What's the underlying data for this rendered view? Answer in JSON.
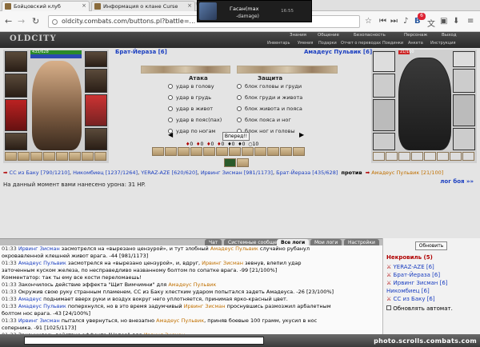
{
  "browser": {
    "tabs": [
      {
        "title": "Бойцовский клуб"
      },
      {
        "title": "Информация о клане Curse"
      }
    ],
    "url": "oldcity.combats.com/buttons.pl?battle=...",
    "notification": {
      "name": "Гасан(max",
      "sub": "-damage)",
      "time": "16:55"
    },
    "badge": "6"
  },
  "game_header": {
    "logo": "OLDCITY",
    "menu": [
      "Знания",
      "Общение",
      "Безопасность",
      "Персонаж",
      "Выход"
    ],
    "submenu": [
      "Инвентарь",
      "Умения",
      "Подарки",
      "Отчет о переводах",
      "Поединки",
      "Анкета",
      "Инструкция"
    ]
  },
  "fighters": {
    "left": {
      "name": "Брат-Йераза [6]",
      "hp": "435/628"
    },
    "right": {
      "name": "Амадеус Пульвик [6]",
      "hp": "21/100"
    }
  },
  "attack": {
    "heading": "Атака",
    "options": [
      "удар в голову",
      "удар в грудь",
      "удар в живот",
      "удар в пояс(пах)",
      "удар по ногам"
    ]
  },
  "defense": {
    "heading": "Защита",
    "options": [
      "блок головы и груди",
      "блок груди и живота",
      "блок живота и пояса",
      "блок пояса и ног",
      "блок ног и головы"
    ]
  },
  "go_button": "Вперед!!",
  "counters": [
    "0",
    "0",
    "0",
    "0",
    "0",
    "0",
    "10"
  ],
  "players_line": {
    "left": [
      "СС из Баку [790/1210]",
      "Никомбиец [1237/1264]",
      "YERAZ-AZE [620/620]",
      "Ирвинг Зисман [981/1173]",
      "Брат-Йераза [435/628]"
    ],
    "vs": "против",
    "right": "Амадеус Пульвик [21/100]"
  },
  "damage_line": "На данный момент вами нанесено урона: 31 HP.",
  "fight_log_link": "лог боя »»",
  "log_tabs": [
    "Чат",
    "Системные сообщения",
    "Все логи",
    "Мои логи",
    "Настройки"
  ],
  "log": [
    {
      "t": "01:33",
      "a": "Ирвинг Зисман",
      "text": " засмотрелся на «вырезано цензурой», и тут злобный ",
      "b": "Амадеус Пульвик",
      "c": " случайно рубанул"
    },
    {
      "t": "",
      "a": "",
      "text": "окровавленной клешней живот врага. -44 [981/1173]",
      "b": "",
      "c": ""
    },
    {
      "t": "01:33",
      "a": "Амадеус Пульвик",
      "text": " засмотрелся на «вырезано цензурой», и, вдруг, ",
      "b": "Ирвинг Зисман",
      "c": " зевнув, влепил удар"
    },
    {
      "t": "",
      "a": "",
      "text": "заточенным куском железа, по несправедливо названному болтом по сопатке врага. -99 [21/100%]",
      "b": "",
      "c": ""
    },
    {
      "t": "",
      "a": "",
      "text": "Комментатор: так ты ему все кости переломаешь!",
      "b": "",
      "c": ""
    },
    {
      "t": "01:33",
      "a": "",
      "text": "Закончилось действие эффекта \"Щит Вимчимни\" для ",
      "b": "Амадеус Пульвик",
      "c": ""
    },
    {
      "t": "01:33",
      "a": "",
      "text": "Окружив свою руку странным пламенем, СС из Баку хлестким ударом попытался задеть Амадеуса. -26 [23/100%]",
      "b": "",
      "c": ""
    },
    {
      "t": "01:33",
      "a": "Амадеус",
      "text": " поднимает вверх руки и воздух вокруг него уплотняется, принимая ярко-красный цвет.",
      "b": "",
      "c": ""
    },
    {
      "t": "01:33",
      "a": "Амадеус Пульвик",
      "text": " поперхнулся, но в это время задумчивый ",
      "b": "Ирвинг Зисман",
      "c": " проснувшись размозжил арбалетным"
    },
    {
      "t": "",
      "a": "",
      "text": "болтом нос врага. -43 [24/100%]",
      "b": "",
      "c": ""
    },
    {
      "t": "01:33",
      "a": "Ирвинг Зисман",
      "text": " пытался увернуться, но внезапно ",
      "b": "Амадеус Пульвик",
      "c": ", приняв боевые 100 грамм, укусил в нос"
    },
    {
      "t": "",
      "a": "",
      "text": "соперника. -91 [1025/1173]",
      "b": "",
      "c": ""
    },
    {
      "t": "01:33",
      "a": "",
      "text": "Закончилось действие эффекта \"Напор\" для ",
      "b": "Ирвинг Зисман",
      "c": ""
    }
  ],
  "sidebar": {
    "refresh": "Обновить",
    "title": "Некровиль (5)",
    "players": [
      "YERAZ-AZE [6]",
      "Брат-Йераза [6]",
      "Ирвинг Зисман [6]",
      "Никомбиец [6]",
      "СС из Баку [6]"
    ],
    "auto": "Обновлять автомат."
  },
  "watermark": "photo.scrolls.combats.com"
}
